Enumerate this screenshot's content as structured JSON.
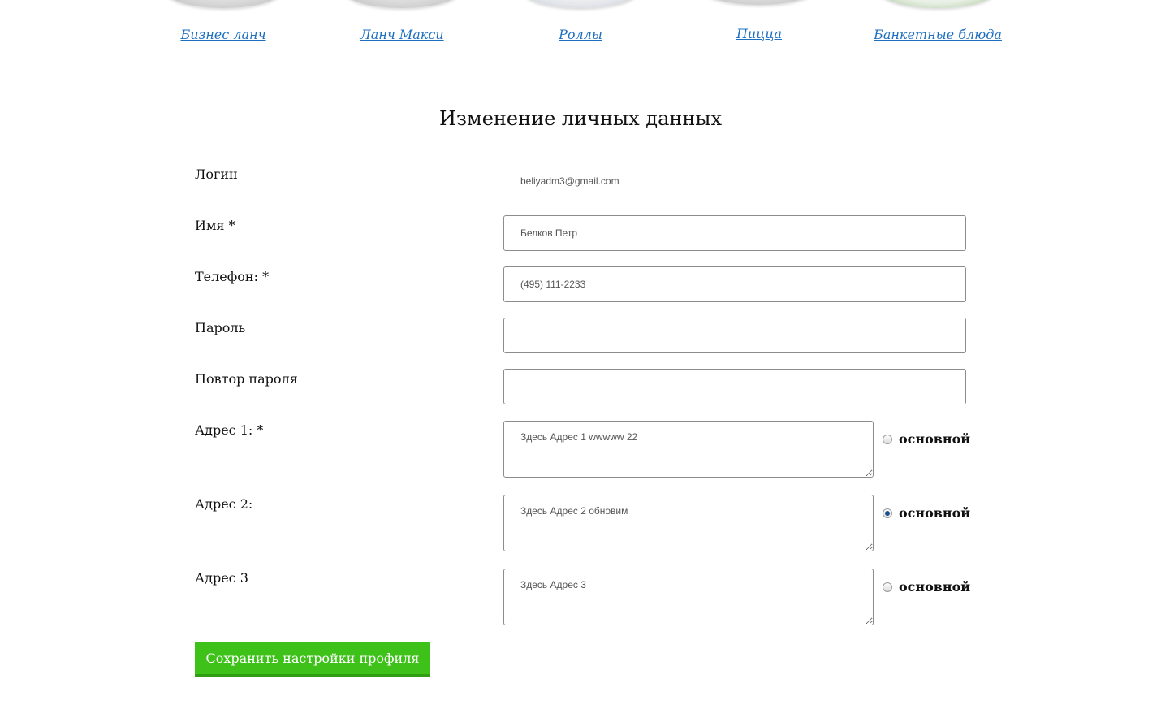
{
  "categories": [
    {
      "label": "Бизнес ланч"
    },
    {
      "label": "Ланч Макси"
    },
    {
      "label": "Роллы"
    },
    {
      "label": "Пицца"
    },
    {
      "label": "Банкетные блюда"
    }
  ],
  "form": {
    "title": "Изменение личных данных",
    "login": {
      "label": "Логин",
      "value": "beliyadm3@gmail.com"
    },
    "name": {
      "label": "Имя *",
      "value": "Белков Петр"
    },
    "phone": {
      "label": "Телефон: *",
      "value": "(495) 111-2233"
    },
    "password": {
      "label": "Пароль",
      "value": ""
    },
    "password_repeat": {
      "label": "Повтор пароля",
      "value": ""
    },
    "address1": {
      "label": "Адрес 1: *",
      "value": "Здесь Адрес 1 wwwww 22",
      "primary_label": "основной",
      "primary": false
    },
    "address2": {
      "label": "Адрес 2:",
      "value": "Здесь Адрес 2 обновим",
      "primary_label": "основной",
      "primary": true
    },
    "address3": {
      "label": "Адрес 3",
      "value": "Здесь Адрес 3",
      "primary_label": "основной",
      "primary": false
    },
    "save_label": "Сохранить настройки профиля"
  },
  "colors": {
    "link": "#1f6fc0",
    "button": "#3ec21a",
    "radio_checked": "#1b4f8c"
  }
}
